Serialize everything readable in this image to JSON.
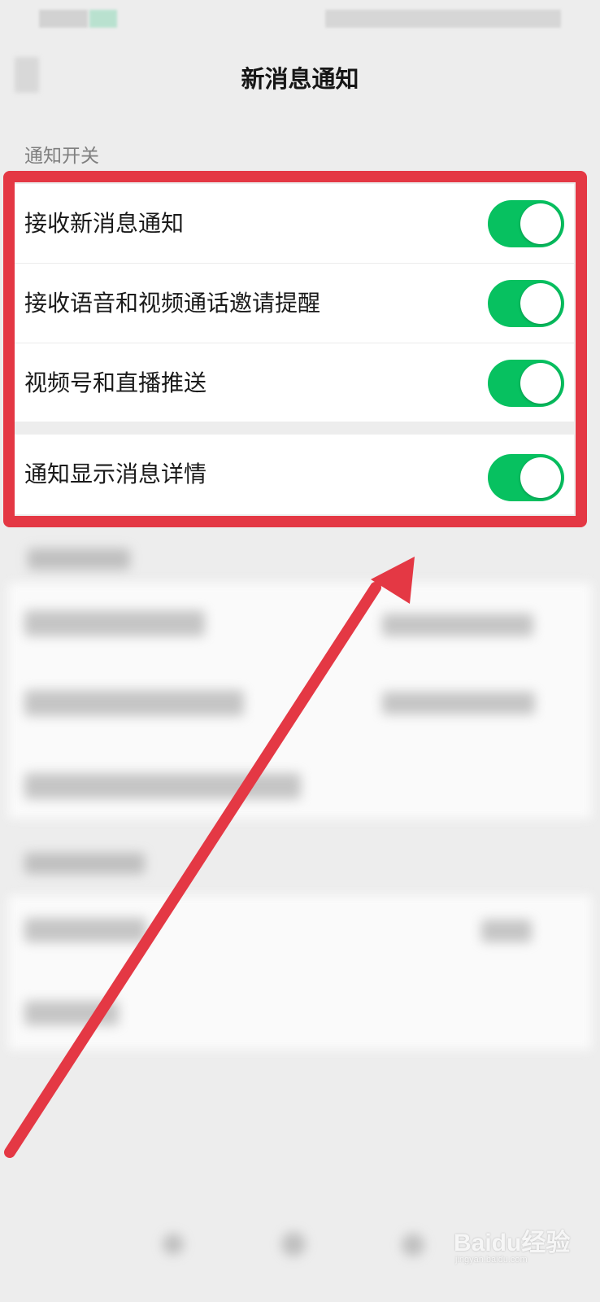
{
  "nav": {
    "title": "新消息通知"
  },
  "section": {
    "header": "通知开关"
  },
  "settings": [
    {
      "label": "接收新消息通知",
      "enabled": true
    },
    {
      "label": "接收语音和视频通话邀请提醒",
      "enabled": true
    },
    {
      "label": "视频号和直播推送",
      "enabled": true
    },
    {
      "label": "通知显示消息详情",
      "enabled": true
    }
  ],
  "colors": {
    "toggle_on": "#07c160",
    "highlight": "#e43844",
    "background": "#ededed"
  },
  "watermark": {
    "brand": "Baidu经验",
    "url": "jingyan.baidu.com"
  }
}
